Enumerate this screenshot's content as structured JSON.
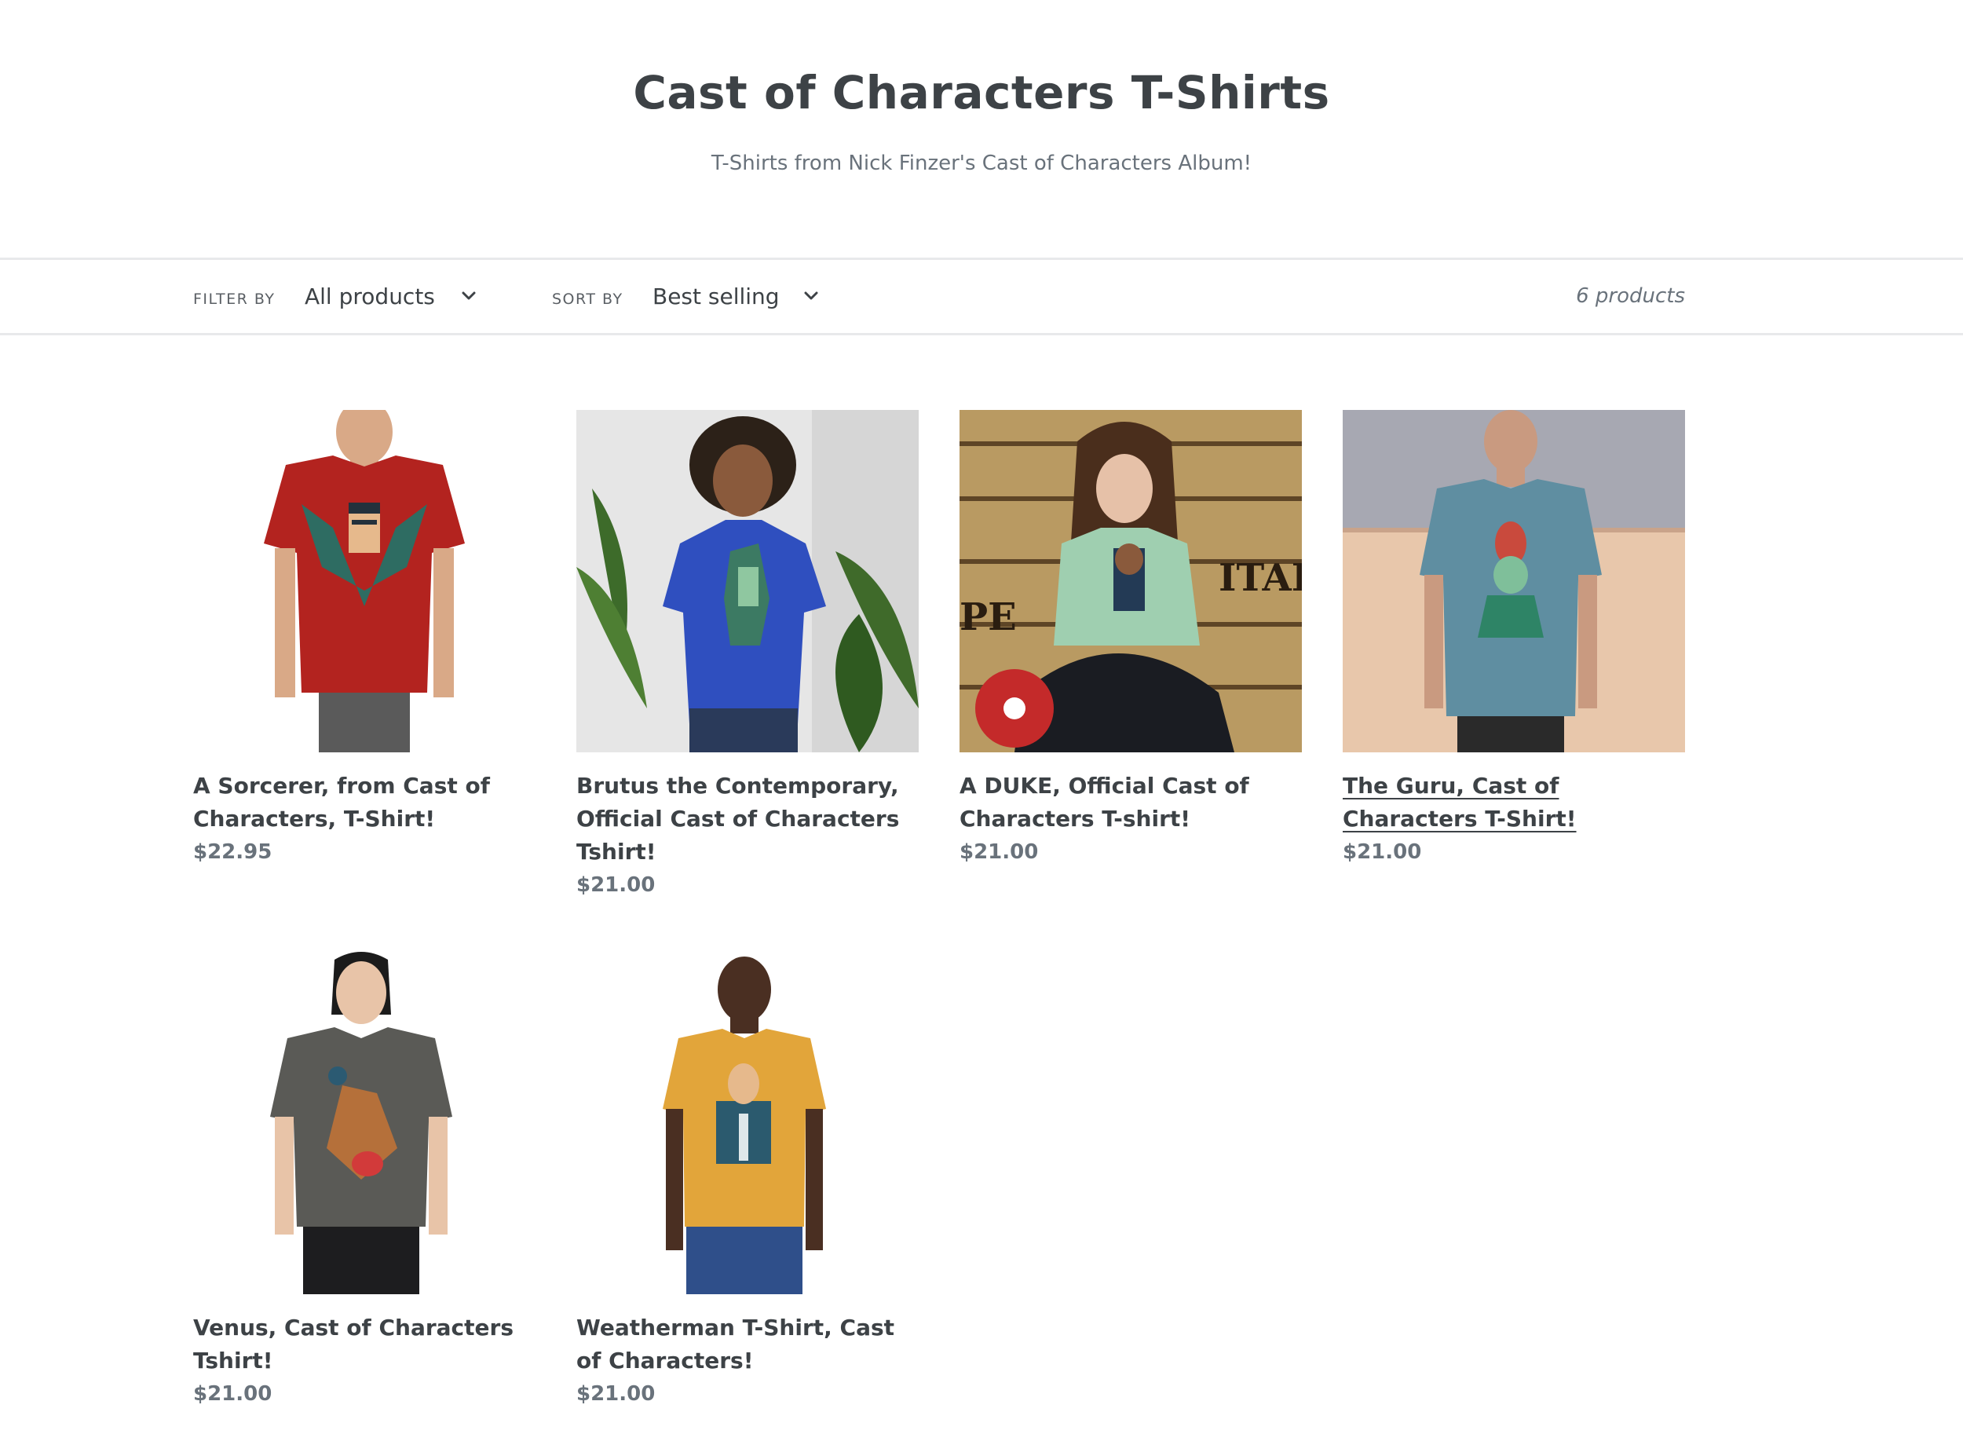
{
  "collection": {
    "title": "Cast of Characters T-Shirts",
    "description": "T-Shirts from Nick Finzer's Cast of Characters Album!"
  },
  "toolbar": {
    "filter_label": "FILTER BY",
    "filter_value": "All products",
    "sort_label": "SORT BY",
    "sort_value": "Best selling",
    "product_count": "6 products",
    "chevron_icon": "chevron-down-icon"
  },
  "products": [
    {
      "title": "A Sorcerer, from Cast of Characters, T-Shirt!",
      "price": "$22.95",
      "shirt_color": "#b3231f",
      "background": "#ffffff"
    },
    {
      "title": "Brutus the Contemporary, Official Cast of Characters Tshirt!",
      "price": "$21.00",
      "shirt_color": "#2f4fbf",
      "background": "#e6e6e6"
    },
    {
      "title": "A DUKE, Official Cast of Characters T-shirt!",
      "price": "$21.00",
      "shirt_color": "#9fcfb0",
      "background": "#b99a62"
    },
    {
      "title": "The Guru, Cast of Characters T-Shirt!",
      "price": "$21.00",
      "shirt_color": "#5f8ea1",
      "background": "#a7a8b2",
      "hovered": true
    },
    {
      "title": "Venus, Cast of Characters Tshirt!",
      "price": "$21.00",
      "shirt_color": "#5a5a56",
      "background": "#ffffff"
    },
    {
      "title": "Weatherman T-Shirt, Cast of Characters!",
      "price": "$21.00",
      "shirt_color": "#e2a53a",
      "background": "#ffffff"
    }
  ]
}
